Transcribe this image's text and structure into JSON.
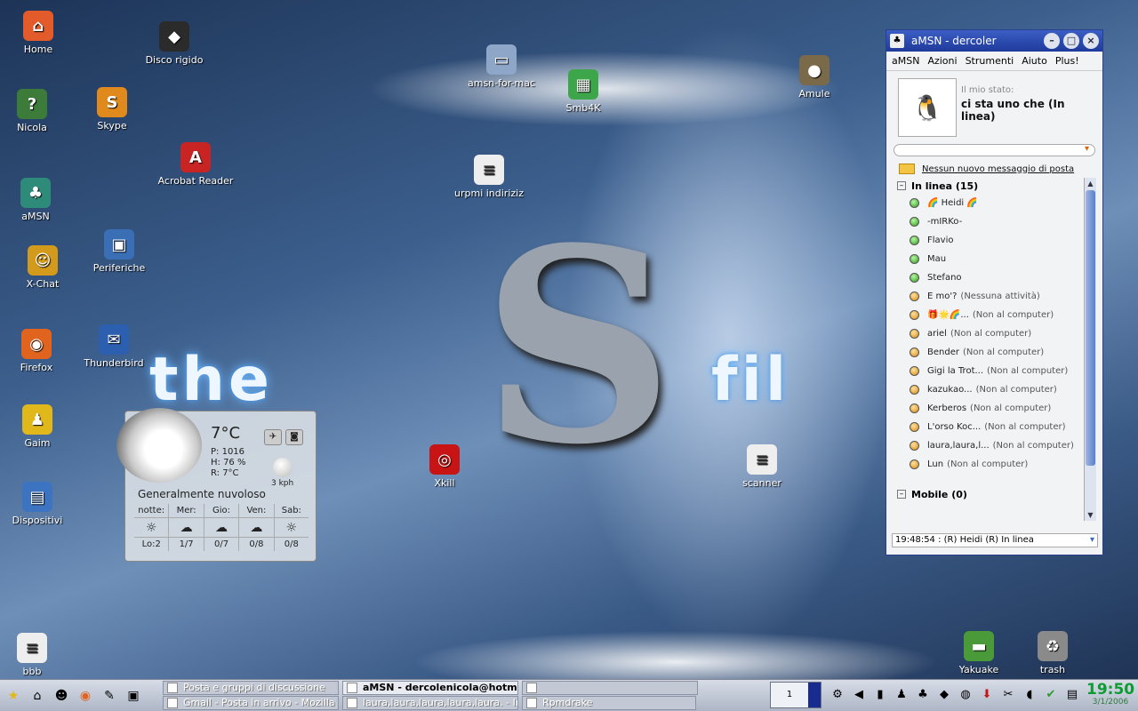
{
  "desktop": {
    "icons": [
      {
        "label": "Home",
        "glyph": "⌂",
        "color": "#e35a2b"
      },
      {
        "label": "Disco rigido",
        "glyph": "◆",
        "color": "#2b2b2b"
      },
      {
        "label": "Nicola",
        "glyph": "?",
        "color": "#3d7b3a"
      },
      {
        "label": "Skype",
        "glyph": "S",
        "color": "#e08a1e"
      },
      {
        "label": "Acrobat Reader",
        "glyph": "A",
        "color": "#c82424"
      },
      {
        "label": "aMSN",
        "glyph": "♣",
        "color": "#2e8b7a"
      },
      {
        "label": "Periferiche",
        "glyph": "▣",
        "color": "#3b6fb5"
      },
      {
        "label": "X-Chat",
        "glyph": "☺",
        "color": "#d49a1c"
      },
      {
        "label": "Firefox",
        "glyph": "◉",
        "color": "#e0641e"
      },
      {
        "label": "Thunderbird",
        "glyph": "✉",
        "color": "#2c5fb0"
      },
      {
        "label": "Gaim",
        "glyph": "♟",
        "color": "#e0b81c"
      },
      {
        "label": "Dispositivi",
        "glyph": "▤",
        "color": "#3c74c2"
      },
      {
        "label": "bbb",
        "glyph": "≡",
        "color": "#eeeeee"
      },
      {
        "label": "amsn-for-mac",
        "glyph": "▭",
        "color": "#8ea7c8"
      },
      {
        "label": "Smb4K",
        "glyph": "▦",
        "color": "#3da64a"
      },
      {
        "label": "urpmi indiriziz",
        "glyph": "≡",
        "color": "#eeeeee"
      },
      {
        "label": "Amule",
        "glyph": "●",
        "color": "#7b6a4a"
      },
      {
        "label": "Xkill",
        "glyph": "◎",
        "color": "#c81414"
      },
      {
        "label": "scanner",
        "glyph": "≡",
        "color": "#eeeeee"
      },
      {
        "label": "Yakuake",
        "glyph": "▬",
        "color": "#4a9a3a"
      },
      {
        "label": "trash",
        "glyph": "♻",
        "color": "#8a8a8a"
      }
    ],
    "banner_left": "the",
    "banner_right": "fil",
    "logo_letter": "S"
  },
  "weather": {
    "temp": "7°C",
    "pressure": "P:  1016",
    "humidity": "H:  76 %",
    "realfeel": "R:  7°C",
    "wind": "3 kph",
    "condition": "Generalmente nuvoloso",
    "forecast": [
      {
        "day": "notte:",
        "value": "Lo:2",
        "icon": "☼"
      },
      {
        "day": "Mer:",
        "value": "1/7",
        "icon": "☁"
      },
      {
        "day": "Gio:",
        "value": "0/7",
        "icon": "☁"
      },
      {
        "day": "Ven:",
        "value": "0/8",
        "icon": "☁"
      },
      {
        "day": "Sab:",
        "value": "0/8",
        "icon": "☼"
      }
    ]
  },
  "amsn": {
    "title": "aMSN - dercoler",
    "menu": [
      "aMSN",
      "Azioni",
      "Strumenti",
      "Aiuto",
      "Plus!"
    ],
    "status_label": "Il mio stato:",
    "status_text": "ci sta uno che  (In linea)",
    "mail_text": "Nessun nuovo messaggio di posta",
    "group_online": "In linea (15)",
    "group_mobile": "Mobile (0)",
    "contacts": [
      {
        "name": "🌈 Heidi 🌈",
        "status": "",
        "state": "on"
      },
      {
        "name": "-mIRKo-",
        "status": "",
        "state": "on"
      },
      {
        "name": "Flavio",
        "status": "",
        "state": "on"
      },
      {
        "name": "Mau",
        "status": "",
        "state": "on"
      },
      {
        "name": "Stefano",
        "status": "",
        "state": "on"
      },
      {
        "name": "E mo'?",
        "status": "(Nessuna attività)",
        "state": "away"
      },
      {
        "name": "🎁🌟🌈...",
        "status": "(Non al computer)",
        "state": "away"
      },
      {
        "name": "ariel",
        "status": "(Non al computer)",
        "state": "away"
      },
      {
        "name": "Bender",
        "status": "(Non al computer)",
        "state": "away"
      },
      {
        "name": "Gigi la Trot...",
        "status": "(Non al computer)",
        "state": "away"
      },
      {
        "name": "kazukao...",
        "status": "(Non al computer)",
        "state": "away"
      },
      {
        "name": "Kerberos",
        "status": "(Non al computer)",
        "state": "away"
      },
      {
        "name": "L'orso Koc...",
        "status": "(Non al computer)",
        "state": "away"
      },
      {
        "name": "laura,laura,l...",
        "status": "(Non al computer)",
        "state": "away"
      },
      {
        "name": "Lun",
        "status": "(Non al computer)",
        "state": "away"
      }
    ],
    "event_text": "19:48:54 : (R) Heidi (R) In linea"
  },
  "taskbar": {
    "tasks": [
      {
        "label": "Posta e gruppi di discussione",
        "active": false
      },
      {
        "label": "aMSN - dercolenicola@hotma",
        "active": true
      },
      {
        "label": "",
        "active": false
      },
      {
        "label": "Gmail - Posta in arrivo - Mozilla F",
        "active": false
      },
      {
        "label": "laura,laura,laura,laura,laura. - In",
        "active": false
      },
      {
        "label": "Rpmdrake",
        "active": false
      }
    ],
    "pager_desktop": "1",
    "clock_time": "19:50",
    "clock_date": "3/1/2006"
  }
}
